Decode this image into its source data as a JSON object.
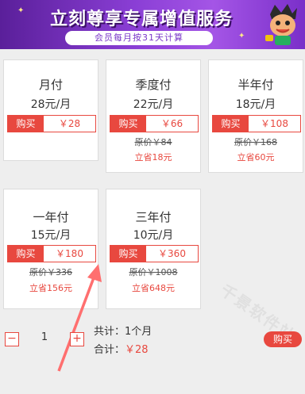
{
  "banner": {
    "title": "立刻尊享专属增值服务",
    "subtitle": "会员每月按31天计算"
  },
  "plans": [
    {
      "name": "月付",
      "per_month": "28元/月",
      "buy_label": "购买",
      "price": "￥28",
      "original": "",
      "saving": ""
    },
    {
      "name": "季度付",
      "per_month": "22元/月",
      "buy_label": "购买",
      "price": "￥66",
      "original": "原价￥84",
      "saving": "立省18元"
    },
    {
      "name": "半年付",
      "per_month": "18元/月",
      "buy_label": "购买",
      "price": "￥108",
      "original": "原价￥168",
      "saving": "立省60元"
    },
    {
      "name": "一年付",
      "per_month": "15元/月",
      "buy_label": "购买",
      "price": "￥180",
      "original": "原价￥336",
      "saving": "立省156元"
    },
    {
      "name": "三年付",
      "per_month": "10元/月",
      "buy_label": "购买",
      "price": "￥360",
      "original": "原价￥1008",
      "saving": "立省648元"
    }
  ],
  "order": {
    "minus": "−",
    "plus": "+",
    "quantity": "1",
    "total_duration_label": "共计：",
    "total_duration_value": "1个月",
    "total_price_label": "合计：",
    "total_price_value": "￥28",
    "buy_label": "购买"
  },
  "watermark": "千景软件站",
  "colors": {
    "accent": "#e8483f",
    "banner": "#8b3fd6"
  }
}
